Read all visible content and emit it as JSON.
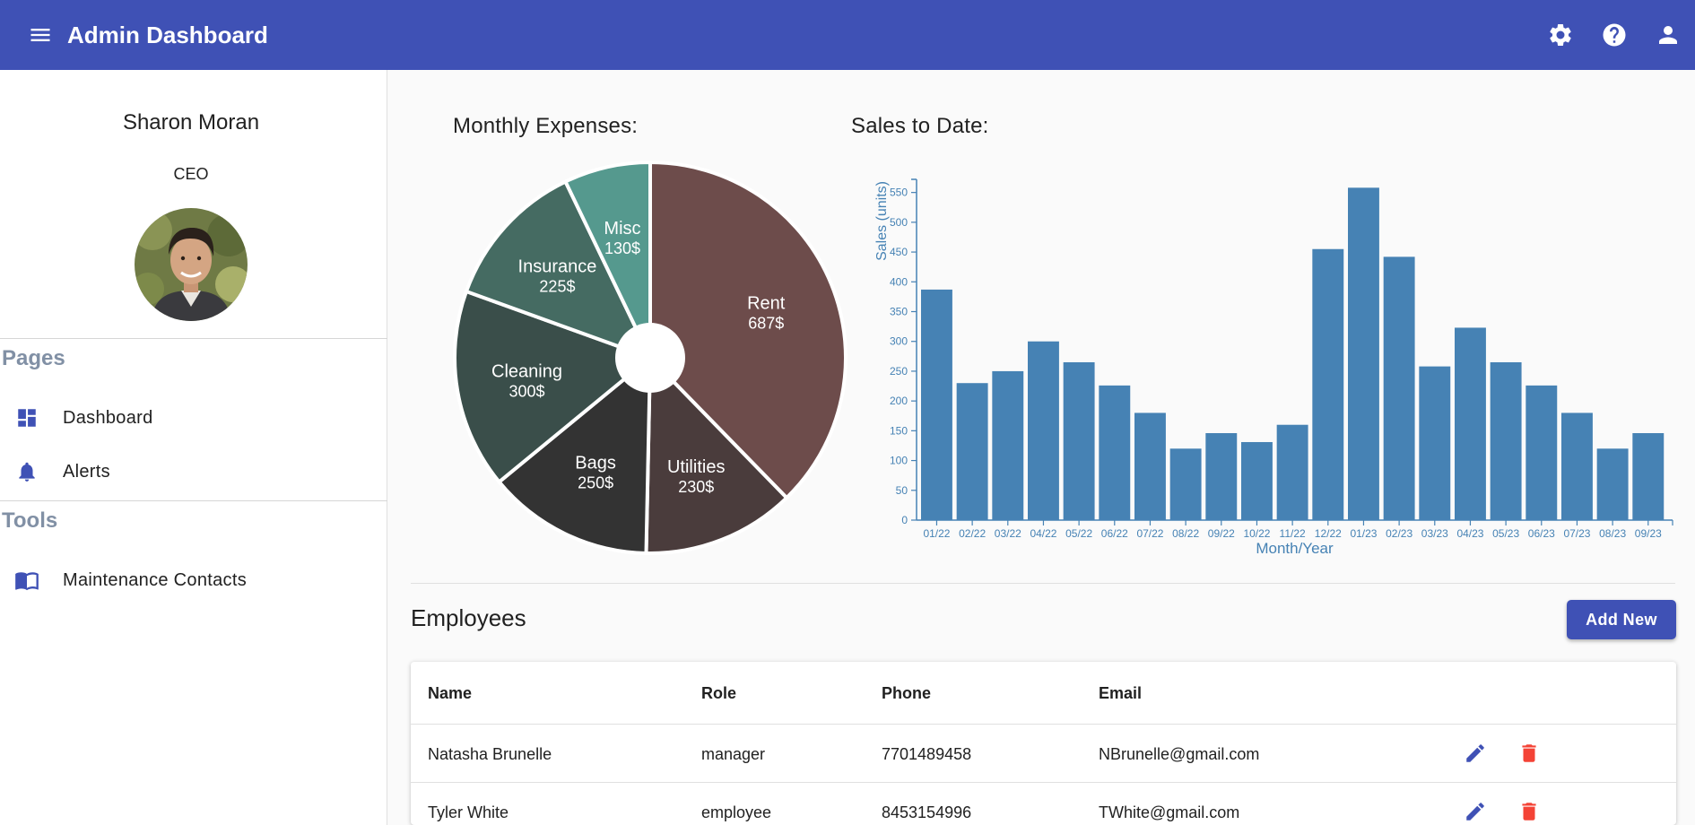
{
  "app": {
    "title": "Admin Dashboard"
  },
  "profile": {
    "name": "Sharon Moran",
    "role": "CEO"
  },
  "nav": {
    "pages_title": "Pages",
    "pages": [
      {
        "label": "Dashboard",
        "icon": "dashboard-icon"
      },
      {
        "label": "Alerts",
        "icon": "bell-icon"
      }
    ],
    "tools_title": "Tools",
    "tools": [
      {
        "label": "Maintenance Contacts",
        "icon": "book-icon"
      }
    ]
  },
  "pie_title": "Monthly Expenses:",
  "bar_title": "Sales to Date:",
  "chart_data": [
    {
      "type": "pie",
      "slices": [
        {
          "label": "Rent",
          "value": 687,
          "value_text": "687$",
          "color": "#6d4c4b"
        },
        {
          "label": "Utilities",
          "value": 230,
          "value_text": "230$",
          "color": "#4a3c3c"
        },
        {
          "label": "Bags",
          "value": 250,
          "value_text": "250$",
          "color": "#333333"
        },
        {
          "label": "Cleaning",
          "value": 300,
          "value_text": "300$",
          "color": "#3a4e4a"
        },
        {
          "label": "Insurance",
          "value": 225,
          "value_text": "225$",
          "color": "#456b62"
        },
        {
          "label": "Misc",
          "value": 130,
          "value_text": "130$",
          "color": "#55998e"
        }
      ]
    },
    {
      "type": "bar",
      "xlabel": "Month/Year",
      "ylabel": "Sales (units)",
      "ylim": [
        0,
        560
      ],
      "yticks": [
        0,
        50,
        100,
        150,
        200,
        250,
        300,
        350,
        400,
        450,
        500,
        550
      ],
      "color": "#4682b4",
      "categories": [
        "01/22",
        "02/22",
        "03/22",
        "04/22",
        "05/22",
        "06/22",
        "07/22",
        "08/22",
        "09/22",
        "10/22",
        "11/22",
        "12/22",
        "01/23",
        "02/23",
        "03/23",
        "04/23",
        "05/23",
        "06/23",
        "07/23",
        "08/23",
        "09/23"
      ],
      "values": [
        387,
        230,
        250,
        300,
        265,
        226,
        180,
        120,
        146,
        131,
        160,
        455,
        558,
        442,
        258,
        323,
        265,
        226,
        180,
        120,
        146
      ]
    }
  ],
  "employees": {
    "title": "Employees",
    "add_label": "Add New",
    "columns": [
      "Name",
      "Role",
      "Phone",
      "Email"
    ],
    "rows": [
      {
        "name": "Natasha Brunelle",
        "role": "manager",
        "phone": "7701489458",
        "email": "NBrunelle@gmail.com"
      },
      {
        "name": "Tyler White",
        "role": "employee",
        "phone": "8453154996",
        "email": "TWhite@gmail.com"
      }
    ]
  },
  "colors": {
    "primary": "#3f51b5",
    "delete": "#f44336"
  }
}
